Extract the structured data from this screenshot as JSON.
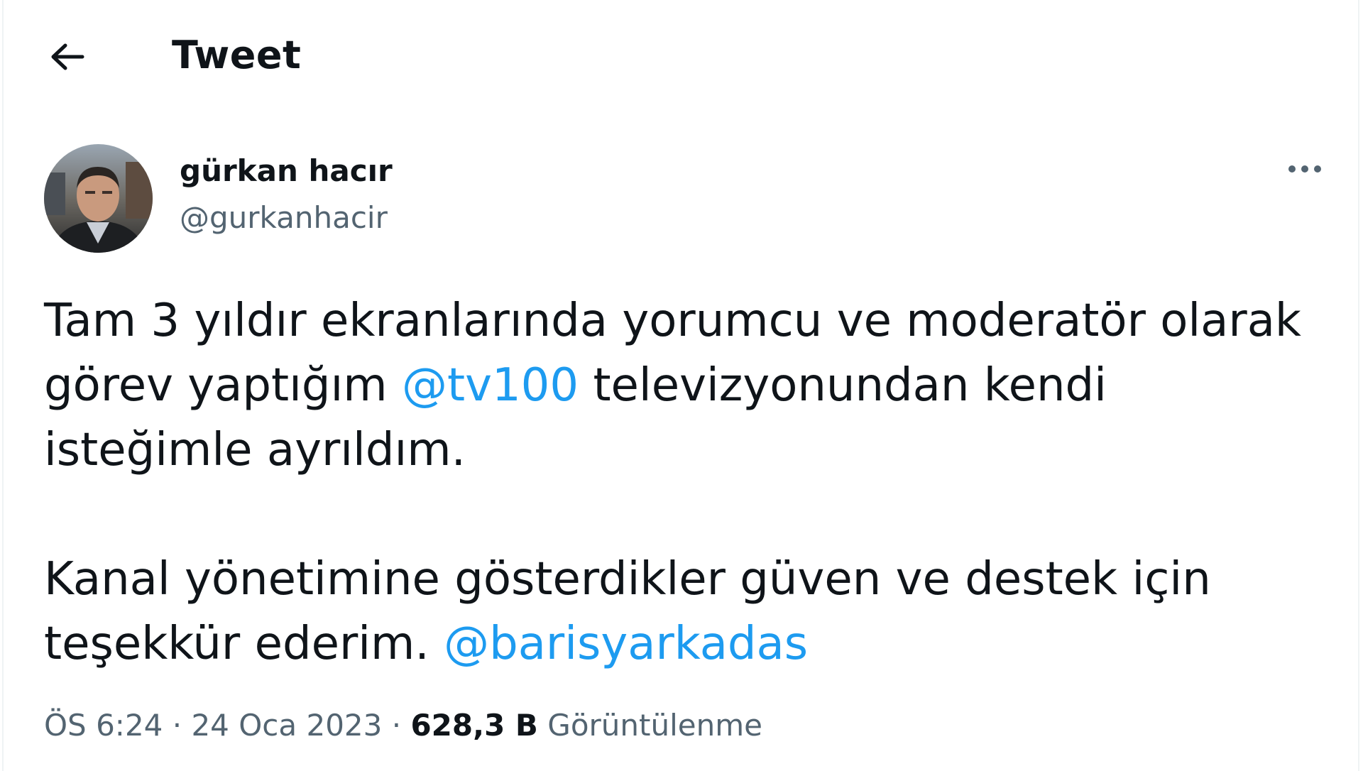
{
  "header": {
    "back_icon": "arrow-left-icon",
    "title": "Tweet"
  },
  "author": {
    "name": "gürkan hacır",
    "handle": "@gurkanhacir",
    "avatar": "avatar-photo"
  },
  "more_icon": "more-horizontal-icon",
  "tweet": {
    "p1_line1": "Tam 3 yıldır ekranlarında yorumcu ve moderatör olarak",
    "p1_line2_a": "görev yaptığım ",
    "mention1": "@tv100",
    "p1_line2_b": " televizyonundan kendi",
    "p1_line3": "isteğimle ayrıldım.",
    "p2_line1": "Kanal yönetimine gösterdikler güven ve destek için",
    "p2_line2_a": "teşekkür ederim. ",
    "mention2": "@barisyarkadas"
  },
  "meta": {
    "time": "ÖS 6:24",
    "sep1": " · ",
    "date": "24 Oca 2023",
    "sep2": " · ",
    "views_count": "628,3 B",
    "views_label": " Görüntülenme"
  },
  "colors": {
    "accent": "#1d9bf0",
    "secondary_text": "#536471",
    "primary_text": "#0f1419"
  }
}
